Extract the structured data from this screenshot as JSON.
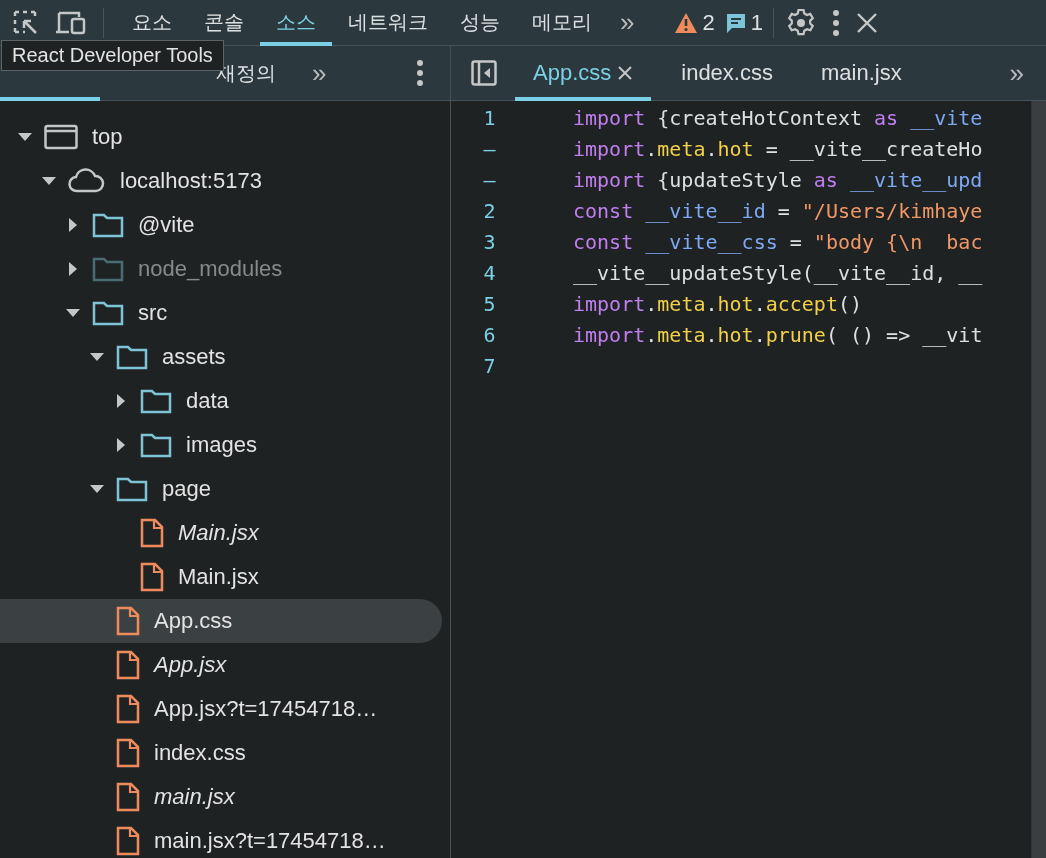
{
  "toolbar": {
    "tabs": [
      {
        "label": "요소",
        "selected": false
      },
      {
        "label": "콘솔",
        "selected": false
      },
      {
        "label": "소스",
        "selected": true
      },
      {
        "label": "네트워크",
        "selected": false
      },
      {
        "label": "성능",
        "selected": false
      },
      {
        "label": "메모리",
        "selected": false
      }
    ],
    "more": "»",
    "warnings": "2",
    "messages": "1"
  },
  "tooltip": "React Developer Tools",
  "navigator": {
    "tabs": [
      {
        "selected": true
      },
      {
        "selected": false
      },
      {
        "label": "재정의",
        "selected": false
      }
    ],
    "more": "»"
  },
  "editor": {
    "tabs": [
      {
        "label": "App.css",
        "selected": true
      },
      {
        "label": "index.css",
        "selected": false
      },
      {
        "label": "main.jsx",
        "selected": false
      }
    ],
    "more": "»",
    "lines": [
      {
        "number": "1",
        "tokens": [
          {
            "kind": "keyword",
            "text": "import"
          },
          {
            "kind": "plain",
            "text": " {createHotContext "
          },
          {
            "kind": "keyword",
            "text": "as"
          },
          {
            "kind": "variable",
            "text": " __vite"
          }
        ]
      },
      {
        "number": "–",
        "tokens": [
          {
            "kind": "keyword",
            "text": "import"
          },
          {
            "kind": "plain",
            "text": "."
          },
          {
            "kind": "property",
            "text": "meta"
          },
          {
            "kind": "plain",
            "text": "."
          },
          {
            "kind": "property",
            "text": "hot"
          },
          {
            "kind": "plain",
            "text": " = __vite__createHo"
          }
        ]
      },
      {
        "number": "–",
        "tokens": [
          {
            "kind": "keyword",
            "text": "import"
          },
          {
            "kind": "plain",
            "text": " {updateStyle "
          },
          {
            "kind": "keyword",
            "text": "as"
          },
          {
            "kind": "variable",
            "text": " __vite__upd"
          }
        ]
      },
      {
        "number": "2",
        "tokens": [
          {
            "kind": "keyword",
            "text": "const"
          },
          {
            "kind": "variable",
            "text": " __vite__id"
          },
          {
            "kind": "plain",
            "text": " = "
          },
          {
            "kind": "string",
            "text": "\"/Users/kimhaye"
          }
        ]
      },
      {
        "number": "3",
        "tokens": [
          {
            "kind": "keyword",
            "text": "const"
          },
          {
            "kind": "variable",
            "text": " __vite__css"
          },
          {
            "kind": "plain",
            "text": " = "
          },
          {
            "kind": "string",
            "text": "\"body {\\n  bac"
          }
        ]
      },
      {
        "number": "4",
        "tokens": [
          {
            "kind": "plain",
            "text": "__vite__updateStyle(__vite__id, __"
          }
        ]
      },
      {
        "number": "5",
        "tokens": [
          {
            "kind": "keyword",
            "text": "import"
          },
          {
            "kind": "plain",
            "text": "."
          },
          {
            "kind": "property",
            "text": "meta"
          },
          {
            "kind": "plain",
            "text": "."
          },
          {
            "kind": "property",
            "text": "hot"
          },
          {
            "kind": "plain",
            "text": "."
          },
          {
            "kind": "property",
            "text": "accept"
          },
          {
            "kind": "plain",
            "text": "()"
          }
        ]
      },
      {
        "number": "6",
        "tokens": [
          {
            "kind": "keyword",
            "text": "import"
          },
          {
            "kind": "plain",
            "text": "."
          },
          {
            "kind": "property",
            "text": "meta"
          },
          {
            "kind": "plain",
            "text": "."
          },
          {
            "kind": "property",
            "text": "hot"
          },
          {
            "kind": "plain",
            "text": "."
          },
          {
            "kind": "property",
            "text": "prune"
          },
          {
            "kind": "plain",
            "text": "( () => __vit"
          }
        ]
      },
      {
        "number": "7"
      }
    ]
  },
  "tree": [
    {
      "kind": "frame",
      "label": "top",
      "expanded": true,
      "children": [
        {
          "kind": "origin",
          "label": "localhost:5173",
          "expanded": true,
          "children": [
            {
              "kind": "folder",
              "label": "@vite",
              "expanded": false,
              "dimmed": false
            },
            {
              "kind": "folder",
              "label": "node_modules",
              "expanded": false,
              "dimmed": true
            },
            {
              "kind": "folder",
              "label": "src",
              "expanded": true,
              "dimmed": false,
              "children": [
                {
                  "kind": "folder",
                  "label": "assets",
                  "expanded": true,
                  "dimmed": false,
                  "children": [
                    {
                      "kind": "folder",
                      "label": "data",
                      "expanded": false,
                      "dimmed": false
                    },
                    {
                      "kind": "folder",
                      "label": "images",
                      "expanded": false,
                      "dimmed": false
                    }
                  ]
                },
                {
                  "kind": "folder",
                  "label": "page",
                  "expanded": true,
                  "dimmed": false,
                  "children": [
                    {
                      "kind": "file",
                      "label": "Main.jsx",
                      "italic": true,
                      "selected": false
                    },
                    {
                      "kind": "file",
                      "label": "Main.jsx",
                      "italic": false,
                      "selected": false
                    }
                  ]
                },
                {
                  "kind": "file",
                  "label": "App.css",
                  "italic": false,
                  "selected": true
                },
                {
                  "kind": "file",
                  "label": "App.jsx",
                  "italic": true,
                  "selected": false
                },
                {
                  "kind": "file",
                  "label": "App.jsx?t=17454718…",
                  "italic": false,
                  "selected": false
                },
                {
                  "kind": "file",
                  "label": "index.css",
                  "italic": false,
                  "selected": false
                },
                {
                  "kind": "file",
                  "label": "main.jsx",
                  "italic": true,
                  "selected": false
                },
                {
                  "kind": "file",
                  "label": "main.jsx?t=17454718…",
                  "italic": false,
                  "selected": false
                }
              ]
            }
          ]
        }
      ]
    }
  ]
}
